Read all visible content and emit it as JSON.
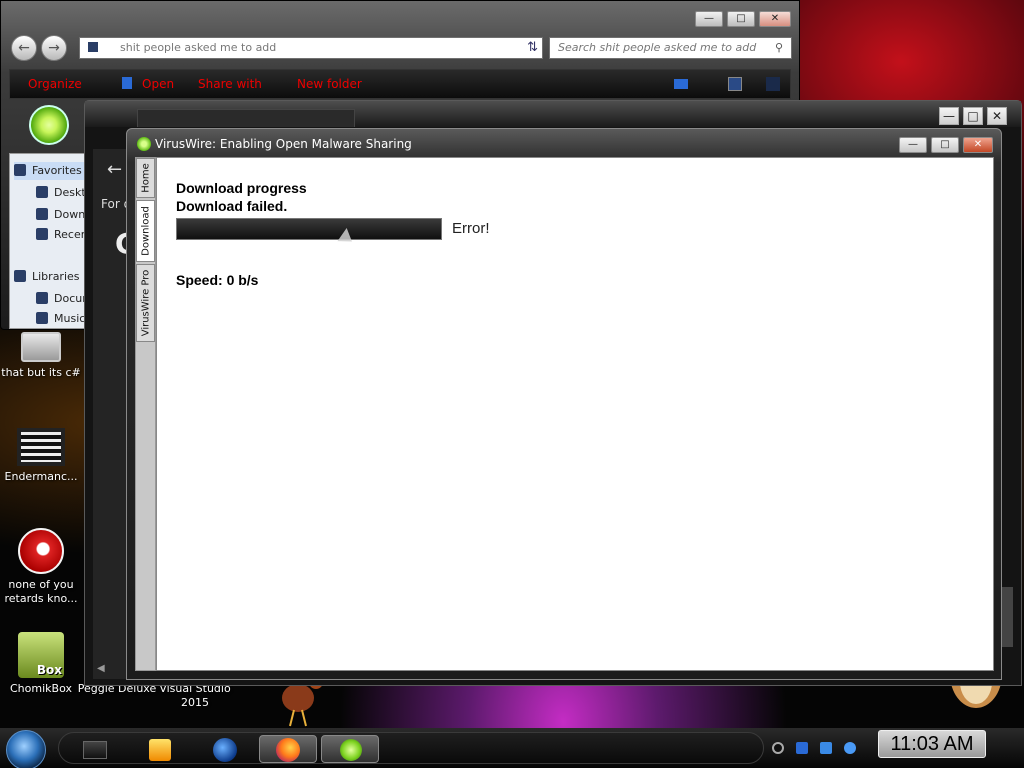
{
  "desktop": {
    "icons": [
      {
        "label": "that but its c#"
      },
      {
        "label": "Endermanc..."
      },
      {
        "label": "none of you retards kno..."
      },
      {
        "label": "ChomikBox"
      },
      {
        "label": "Peggle Deluxe"
      },
      {
        "label": "Visual Studio 2015"
      }
    ],
    "chomik_badge": "Box"
  },
  "explorer": {
    "address": "shit people asked me to add",
    "search_placeholder": "Search shit people asked me to add",
    "commands": [
      "Organize",
      "Open",
      "Share with",
      "New folder"
    ],
    "nav_items": [
      "Favorites",
      "Desktop",
      "Downloads",
      "Recent",
      "Libraries",
      "Documents",
      "Music"
    ],
    "accent_color": "#e00000"
  },
  "midwin": {
    "for_text": "For d",
    "big_letter": "C"
  },
  "app": {
    "title": "VirusWire: Enabling Open Malware Sharing",
    "tabs": [
      "Home",
      "Download",
      "VirusWire Pro"
    ],
    "active_tab": "Download",
    "content": {
      "heading": "Download progress",
      "status": "Download failed.",
      "progress": 0,
      "error_label": "Error!",
      "speed": "Speed: 0 b/s"
    }
  },
  "taskbar": {
    "clock": "11:03 AM",
    "apps": [
      "explorer",
      "media-player",
      "browser",
      "firefox",
      "viruswire"
    ]
  }
}
